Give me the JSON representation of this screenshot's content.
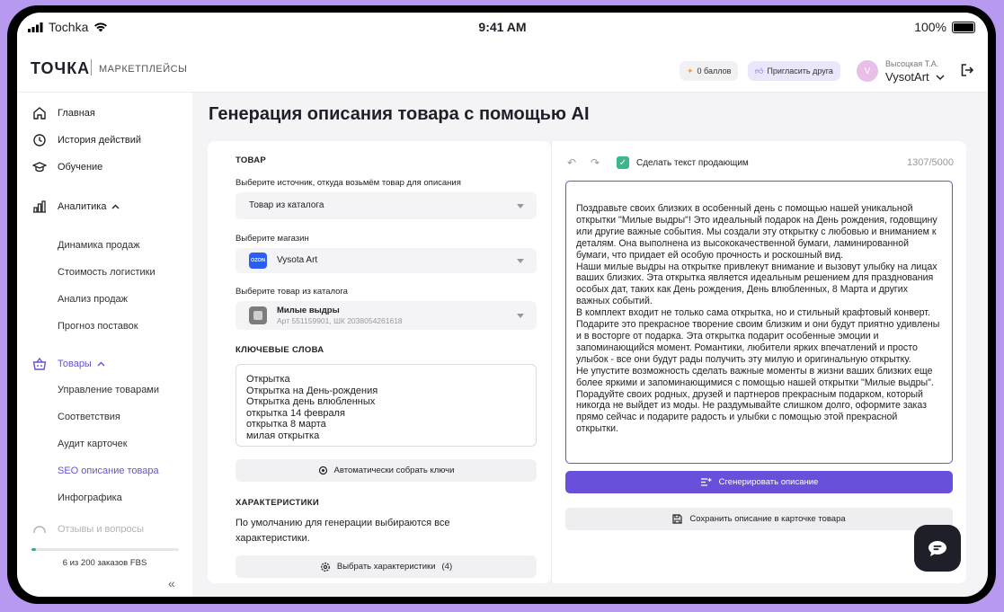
{
  "status_bar": {
    "carrier": "Tochka",
    "time": "9:41 AM",
    "battery": "100%"
  },
  "header": {
    "logo": "ТОЧКА",
    "section": "МАРКЕТПЛЕЙСЫ",
    "points": "0 баллов",
    "invite": "Пригласить друга",
    "avatar_letter": "V",
    "user_name": "Высоцкая Т.А.",
    "shop": "VysotArt"
  },
  "sidebar": {
    "items": [
      {
        "label": "Главная",
        "icon": "home-icon"
      },
      {
        "label": "История действий",
        "icon": "history-icon"
      },
      {
        "label": "Обучение",
        "icon": "graduation-cap-icon"
      }
    ],
    "analytics": {
      "label": "Аналитика",
      "icon": "chart-icon",
      "children": [
        "Динамика продаж",
        "Стоимость логистики",
        "Анализ продаж",
        "Прогноз поставок"
      ]
    },
    "goods": {
      "label": "Товары",
      "icon": "basket-icon",
      "children": [
        "Управление товарами",
        "Соответствия",
        "Аудит карточек",
        "SEO описание товара",
        "Инфографика"
      ],
      "active_index": 3
    },
    "partial_item": "Отзывы и вопросы",
    "fbs_label": "6 из 200 заказов FBS",
    "fbs_progress": 0.03,
    "collapse_icon": "double-chevron-left-icon"
  },
  "page": {
    "title": "Генерация описания товара с помощью AI"
  },
  "left_card": {
    "product_header": "ТОВАР",
    "source_label": "Выберите источник, откуда возьмём товар для описания",
    "source_value": "Товар из каталога",
    "store_label": "Выберите магазин",
    "store_badge": "OZON",
    "store_value": "Vysota Art",
    "catalog_label": "Выберите товар из каталога",
    "product_name": "Милые выдры",
    "product_meta": "Арт 551159901, ШК 2038054261618",
    "keywords_header": "КЛЮЧЕВЫЕ СЛОВА",
    "keywords": [
      "Открытка",
      "Открытка на День-рождения",
      "Открытка день влюбленных",
      "открытка 14 февраля",
      "открытка 8 марта",
      "милая открытка"
    ],
    "auto_collect": "Автоматически собрать ключи",
    "chars_header": "ХАРАКТЕРИСТИКИ",
    "chars_text": "По умолчанию для генерации выбираются все характеристики.",
    "select_chars": "Выбрать характеристики",
    "select_chars_count": "(4)"
  },
  "right_card": {
    "selling_text_label": "Сделать текст продающим",
    "selling_checked": true,
    "counter": "1307/5000",
    "description": [
      "Поздравьте своих близких в особенный день с помощью нашей уникальной открытки \"Милые выдры\"! Это идеальный подарок на День рождения, годовщину или другие важные события. Мы создали эту открытку с любовью и вниманием к деталям. Она выполнена из высококачественной бумаги, ламинированной бумаги, что придает ей особую прочность и роскошный вид.",
      "Наши милые выдры на открытке привлекут внимание и вызовут улыбку на лицах ваших близких. Эта открытка является идеальным решением для празднования особых дат, таких как День рождения, День влюбленных, 8 Марта и других важных событий.",
      "В комплект входит не только сама открытка, но и стильный крафтовый конверт.",
      "Подарите это прекрасное творение своим близким и они будут приятно удивлены и в восторге от подарка. Эта открытка подарит особенные эмоции и запоминающийся момент. Романтики, любители ярких впечатлений и просто улыбок - все они будут рады получить эту милую и оригинальную открытку.",
      "Не упустите возможность сделать важные моменты в жизни ваших близких еще более яркими и запоминающимися с помощью нашей открытки \"Милые выдры\". Порадуйте своих родных, друзей и партнеров прекрасным подарком, который никогда не выйдет из моды. Не раздумывайте слишком долго, оформите заказ прямо сейчас и подарите радость и улыбки с помощью этой прекрасной открытки."
    ],
    "generate": "Сгенерировать описание",
    "save": "Сохранить описание в карточке товара"
  },
  "colors": {
    "accent": "#6a4fdb",
    "background": "#b79af0",
    "check": "#3cb68f",
    "progress": "#3cb371"
  }
}
